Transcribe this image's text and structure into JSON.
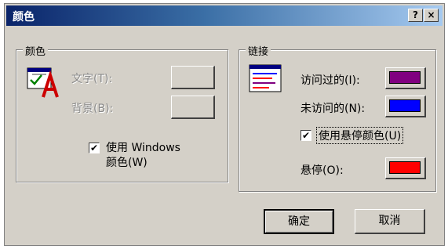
{
  "window": {
    "title": "颜色",
    "help_button": "?",
    "close_button": "×"
  },
  "colors_group": {
    "legend": "颜色",
    "text_label": "文字(T):",
    "background_label": "背景(B):",
    "use_windows_label_line1": "使用 Windows",
    "use_windows_label_line2": "颜色(W)",
    "use_windows_checked": true
  },
  "links_group": {
    "legend": "链接",
    "visited_label": "访问过的(I):",
    "visited_color": "#800080",
    "unvisited_label": "未访问的(N):",
    "unvisited_color": "#0000ff",
    "use_hover_label": "使用悬停颜色(U)",
    "use_hover_checked": true,
    "hover_label": "悬停(O):",
    "hover_color": "#ff0000"
  },
  "buttons": {
    "ok": "确定",
    "cancel": "取消"
  },
  "theme": {
    "title_bar_start": "#0a246a",
    "dialog_face": "#d4d0c8"
  }
}
